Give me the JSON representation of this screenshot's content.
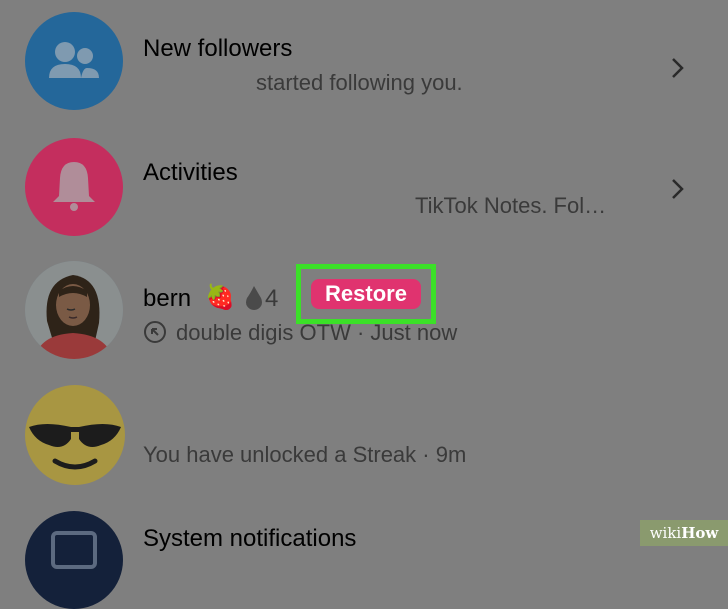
{
  "items": [
    {
      "title": "New followers",
      "subtitle": "started following you.",
      "avatar_icon": "people-icon",
      "avatar_color": "#24679a"
    },
    {
      "title": "Activities",
      "subtitle": "TikTok Notes. Fol…",
      "avatar_icon": "bell-icon",
      "avatar_color": "#c42e5e"
    },
    {
      "title": "bern",
      "streak_count": "4",
      "subtitle": "double digis OTW · Just now",
      "restore_label": "Restore"
    },
    {
      "subtitle": "You have unlocked a Streak · 9m"
    },
    {
      "title": "System notifications",
      "avatar_color": "#14213a"
    }
  ],
  "watermark": {
    "wiki": "wiki",
    "how": "How"
  },
  "colors": {
    "highlight_border": "#3be028",
    "restore_button": "#e0336f",
    "overlay": "#7f7f7f"
  }
}
